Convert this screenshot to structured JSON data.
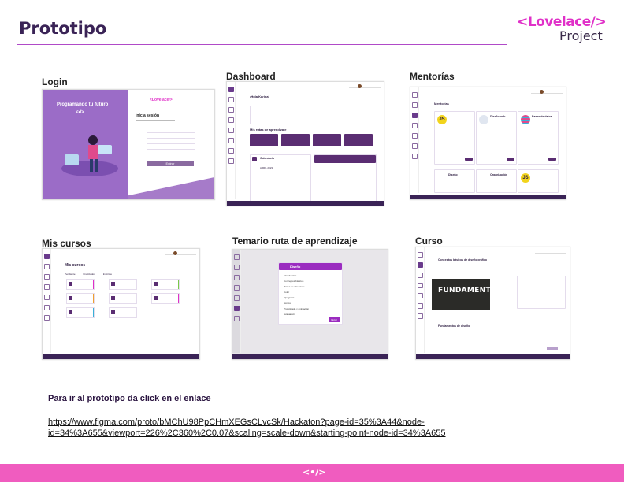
{
  "header": {
    "title": "Prototipo",
    "logo_line1": "<Lovelace/>",
    "logo_line2": "Project"
  },
  "screens": {
    "login": {
      "label": "Login",
      "tagline": "Programando tu futuro",
      "code": "<•/>",
      "heading": "Inicia sesión",
      "button": "Entrar"
    },
    "dashboard": {
      "label": "Dashboard",
      "greeting": "¡Hola Karina!",
      "section": "Mis rutas de aprendizaje",
      "calendar": "Calendario",
      "month": "ABRIL 2023"
    },
    "mentorias": {
      "label": "Mentorías",
      "heading": "Mentorías",
      "cards": [
        "JS",
        "Diseño web",
        "Bases de datos",
        "Diseño",
        "Organización",
        "JS"
      ]
    },
    "mis_cursos": {
      "label": "Mis cursos",
      "heading": "Mis cursos",
      "tabs": [
        "Pendiente",
        "Finalizados",
        "Inscritos"
      ]
    },
    "temario": {
      "label": "Temario ruta de aprendizaje",
      "modal_title": "Diseño",
      "items": [
        "Introducción",
        "Conceptos básicos",
        "Bases de wireframe",
        "Color",
        "Tipografía",
        "Íconos",
        "Prototipado y animación",
        "Evaluación"
      ],
      "button": "Iniciar"
    },
    "curso": {
      "label": "Curso",
      "heading": "Conceptos básicos de diseño gráfico",
      "video_text": "FUNDAMENTOS",
      "section": "Fundamentos de diseño"
    }
  },
  "cta": "Para ir al prototipo da click  en el enlace",
  "link": "https://www.figma.com/proto/bMChU98PpCHmXEGsCLvcSk/Hackaton?page-id=35%3A44&node-id=34%3A655&viewport=226%2C360%2C0.07&scaling=scale-down&starting-point-node-id=34%3A655",
  "footer_logo": "<•/>",
  "colors": {
    "accent": "#f05cbf",
    "purple": "#3a2356",
    "brand_pink": "#e030c8"
  }
}
